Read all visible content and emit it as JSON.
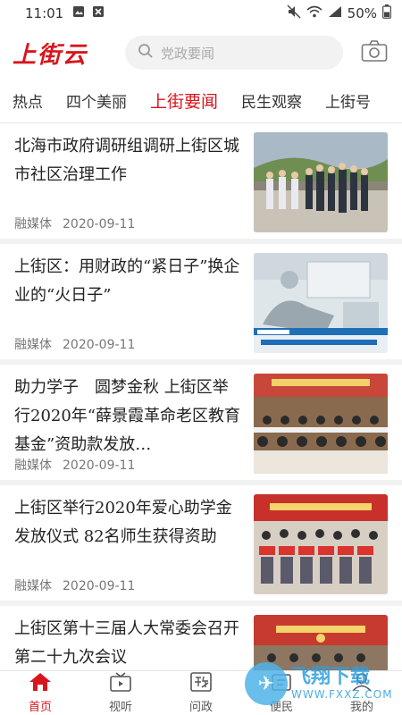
{
  "status_bar": {
    "time": "11:01",
    "battery": "50%"
  },
  "header": {
    "logo": "上街云",
    "search_placeholder": "党政要闻"
  },
  "tabs": [
    {
      "label": "热点"
    },
    {
      "label": "四个美丽"
    },
    {
      "label": "上街要闻",
      "active": true
    },
    {
      "label": "民生观察"
    },
    {
      "label": "上街号"
    }
  ],
  "articles": [
    {
      "title": "北海市政府调研组调研上街区城市社区治理工作",
      "source": "融媒体",
      "date": "2020-09-11"
    },
    {
      "title": "上街区：用财政的“紧日子”换企业的“火日子”",
      "source": "融媒体",
      "date": "2020-09-11"
    },
    {
      "title": "助力学子　圆梦金秋 上街区举行2020年“薛景霞革命老区教育基金”资助款发放…",
      "source": "融媒体",
      "date": "2020-09-11"
    },
    {
      "title": "上街区举行2020年爱心助学金发放仪式 82名师生获得资助",
      "source": "融媒体",
      "date": "2020-09-11"
    },
    {
      "title": "上街区第十三届人大常委会召开第二十九次会议",
      "source": "",
      "date": ""
    }
  ],
  "bottom_nav": [
    {
      "label": "首页",
      "active": true
    },
    {
      "label": "视听"
    },
    {
      "label": "问政"
    },
    {
      "label": "便民"
    },
    {
      "label": "我的"
    }
  ],
  "watermark": {
    "brand": "飞翔下载",
    "url": "WWW.FXXZ.COM"
  },
  "colors": {
    "accent": "#d7161d",
    "divider": "#f2f2f2"
  }
}
